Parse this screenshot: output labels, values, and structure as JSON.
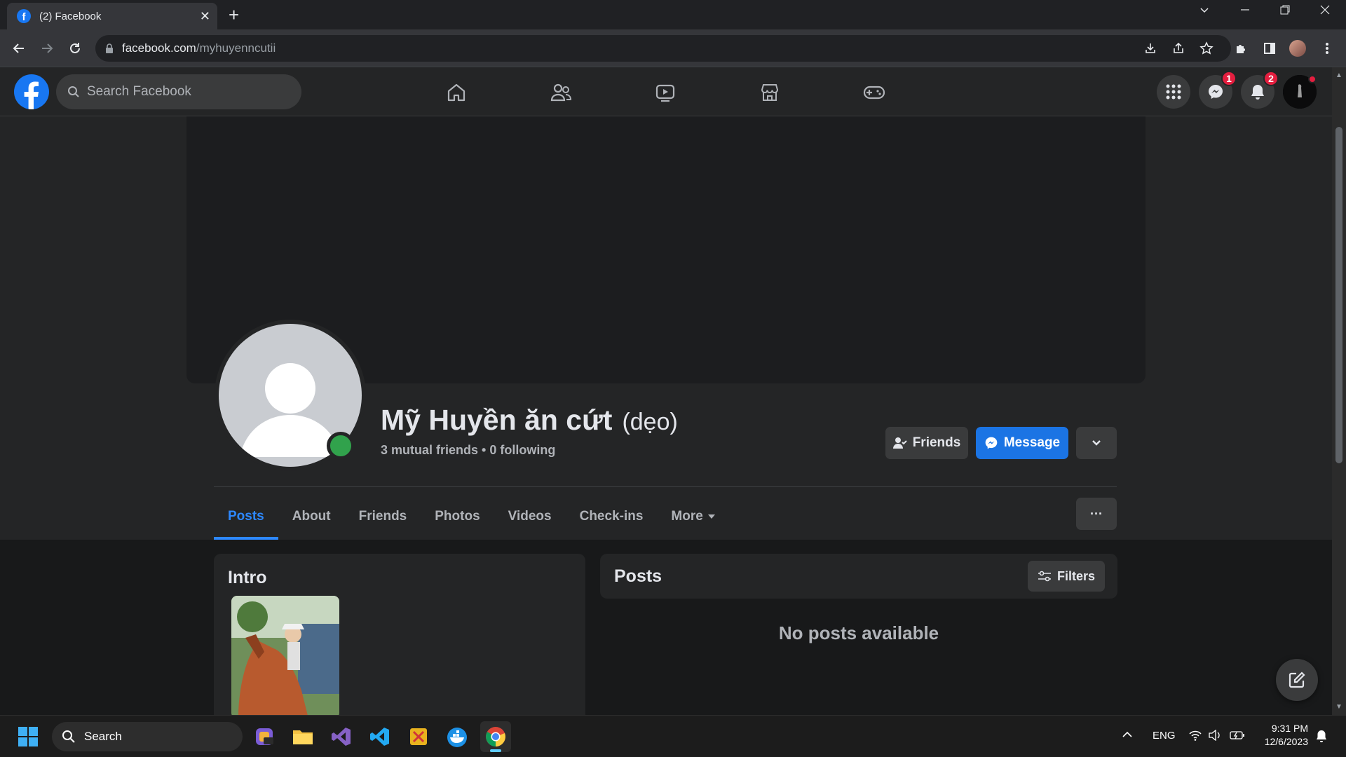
{
  "browser": {
    "tab_title": "(2) Facebook",
    "tab_close": "✕",
    "new_tab": "+",
    "url_host": "facebook.com",
    "url_path": "/myhuyenncutii"
  },
  "fb": {
    "search_placeholder": "Search Facebook",
    "nav_items": [
      "home-icon",
      "friends-icon",
      "watch-icon",
      "marketplace-icon",
      "gaming-icon"
    ],
    "messenger_badge": "1",
    "notifications_badge": "2",
    "accent": "#1877f2"
  },
  "profile": {
    "name": "Mỹ Huyền ăn cứt",
    "alt_name": "(dẹo)",
    "mutual": "3 mutual friends",
    "sep": "•",
    "following": "0 following",
    "friends_button": "Friends",
    "message_button": "Message",
    "tabs": [
      "Posts",
      "About",
      "Friends",
      "Photos",
      "Videos",
      "Check-ins",
      "More"
    ],
    "active_tab": "Posts",
    "more_button": "···"
  },
  "intro": {
    "title": "Intro"
  },
  "posts": {
    "title": "Posts",
    "filters_button": "Filters",
    "empty_text": "No posts available"
  },
  "taskbar": {
    "search_label": "Search",
    "lang": "ENG",
    "time": "9:31 PM",
    "date": "12/6/2023"
  }
}
